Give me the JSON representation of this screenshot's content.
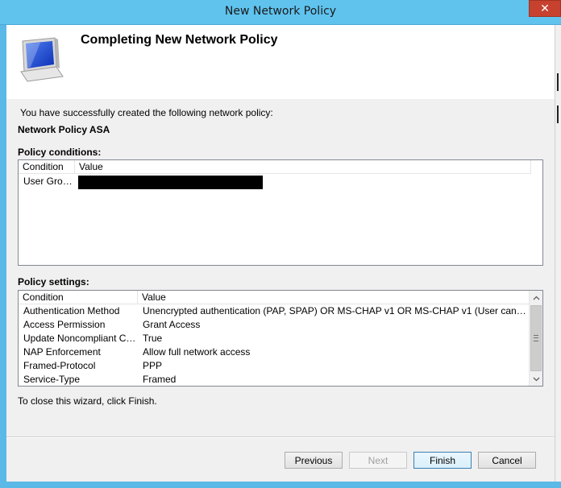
{
  "window": {
    "title": "New Network Policy",
    "close_label": "✕"
  },
  "header": {
    "title": "Completing New Network Policy"
  },
  "intro_text": "You have successfully created the following network policy:",
  "policy_name": "Network Policy ASA",
  "conditions": {
    "label": "Policy conditions:",
    "columns": [
      "Condition",
      "Value"
    ],
    "rows": [
      {
        "condition": "User Groups",
        "value": ""
      }
    ]
  },
  "settings": {
    "label": "Policy settings:",
    "columns": [
      "Condition",
      "Value"
    ],
    "rows": [
      {
        "condition": "Authentication Method",
        "value": "Unencrypted authentication (PAP, SPAP) OR MS-CHAP v1 OR MS-CHAP v1 (User can change p..."
      },
      {
        "condition": "Access Permission",
        "value": "Grant Access"
      },
      {
        "condition": "Update Noncompliant Clients",
        "value": "True"
      },
      {
        "condition": "NAP Enforcement",
        "value": "Allow full network access"
      },
      {
        "condition": "Framed-Protocol",
        "value": "PPP"
      },
      {
        "condition": "Service-Type",
        "value": "Framed"
      }
    ]
  },
  "close_instruction": "To close this wizard, click Finish.",
  "buttons": {
    "previous": "Previous",
    "next": "Next",
    "finish": "Finish",
    "cancel": "Cancel"
  },
  "icons": {
    "wizard": "computer-monitor-icon",
    "scroll_up": "chevron-up-icon",
    "scroll_down": "chevron-down-icon"
  }
}
